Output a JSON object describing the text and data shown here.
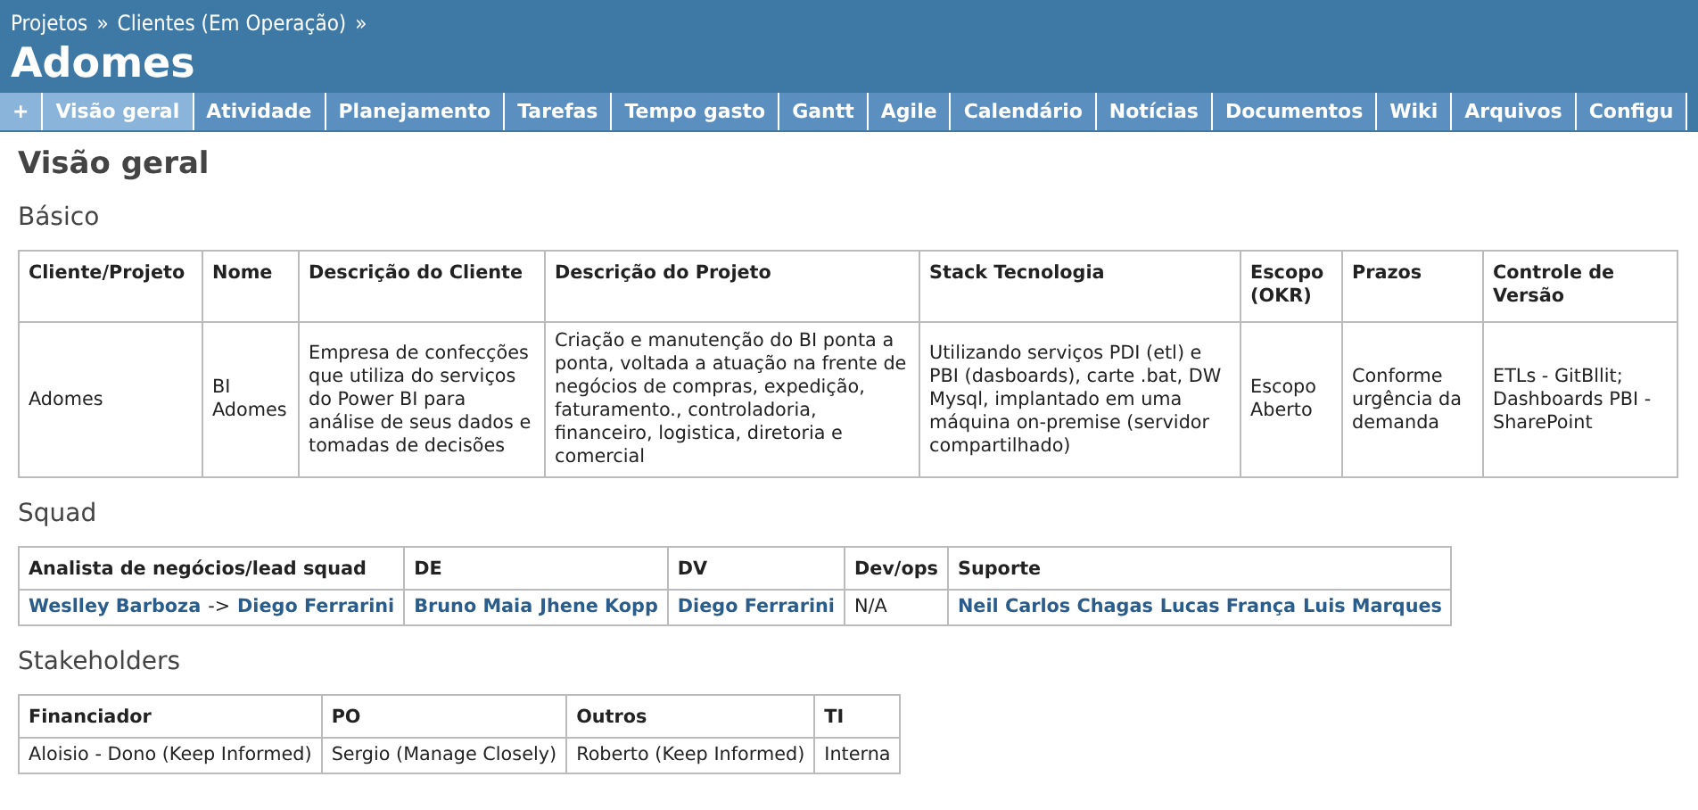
{
  "breadcrumb": [
    {
      "label": "Projetos"
    },
    {
      "label": "Clientes (Em Operação)"
    }
  ],
  "breadcrumb_separator": "»",
  "project_title": "Adomes",
  "new_button": {
    "label": "+"
  },
  "tabs": [
    {
      "label": "Visão geral",
      "selected": true
    },
    {
      "label": "Atividade",
      "selected": false
    },
    {
      "label": "Planejamento",
      "selected": false
    },
    {
      "label": "Tarefas",
      "selected": false
    },
    {
      "label": "Tempo gasto",
      "selected": false
    },
    {
      "label": "Gantt",
      "selected": false
    },
    {
      "label": "Agile",
      "selected": false
    },
    {
      "label": "Calendário",
      "selected": false
    },
    {
      "label": "Notícias",
      "selected": false
    },
    {
      "label": "Documentos",
      "selected": false
    },
    {
      "label": "Wiki",
      "selected": false
    },
    {
      "label": "Arquivos",
      "selected": false
    },
    {
      "label": "Configu",
      "selected": false
    }
  ],
  "page_title": "Visão geral",
  "sections": [
    {
      "title": "Básico",
      "columns": [
        "Cliente/Projeto",
        "Nome",
        "Descrição do Cliente",
        "Descrição do Projeto",
        "Stack Tecnologia",
        "Escopo (OKR)",
        "Prazos",
        "Controle de Versão"
      ],
      "rows": [
        [
          [
            {
              "kind": "text",
              "text": "Adomes"
            }
          ],
          [
            {
              "kind": "text",
              "text": "BI Adomes"
            }
          ],
          [
            {
              "kind": "text",
              "text": "Empresa de confecções que utiliza do serviços do Power BI para análise de seus dados e tomadas de decisões"
            }
          ],
          [
            {
              "kind": "text",
              "text": "Criação e manutenção do BI ponta a ponta, voltada a atuação na frente de negócios de compras, expedição, faturamento., controladoria, financeiro, logistica, diretoria e comercial"
            }
          ],
          [
            {
              "kind": "text",
              "text": "Utilizando serviços PDI (etl) e PBI (dasboards), carte .bat, DW Mysql, implantado em uma máquina on-premise (servidor compartilhado)"
            }
          ],
          [
            {
              "kind": "text",
              "text": "Escopo Aberto"
            }
          ],
          [
            {
              "kind": "text",
              "text": "Conforme urgência da demanda"
            }
          ],
          [
            {
              "kind": "text",
              "text": "ETLs - GitBllit; Dashboards PBI - SharePoint"
            }
          ]
        ]
      ]
    },
    {
      "title": "Squad",
      "columns": [
        "Analista de negócios/lead squad",
        "DE",
        "DV",
        "Dev/ops",
        "Suporte"
      ],
      "rows": [
        [
          [
            {
              "kind": "link",
              "text": "Weslley Barboza"
            },
            {
              "kind": "text",
              "text": "->"
            },
            {
              "kind": "link",
              "text": "Diego Ferrarini"
            }
          ],
          [
            {
              "kind": "link",
              "text": "Bruno Maia"
            },
            {
              "kind": "link",
              "text": "Jhene Kopp"
            }
          ],
          [
            {
              "kind": "link",
              "text": "Diego Ferrarini"
            }
          ],
          [
            {
              "kind": "text",
              "text": "N/A"
            }
          ],
          [
            {
              "kind": "link",
              "text": "Neil Carlos Chagas"
            },
            {
              "kind": "link",
              "text": "Lucas França"
            },
            {
              "kind": "link",
              "text": "Luis Marques"
            }
          ]
        ]
      ]
    },
    {
      "title": "Stakeholders",
      "columns": [
        "Financiador",
        "PO",
        "Outros",
        "TI"
      ],
      "rows": [
        [
          [
            {
              "kind": "text",
              "text": "Aloisio - Dono (Keep Informed)"
            }
          ],
          [
            {
              "kind": "text",
              "text": "Sergio (Manage Closely)"
            }
          ],
          [
            {
              "kind": "text",
              "text": "Roberto (Keep Informed)"
            }
          ],
          [
            {
              "kind": "text",
              "text": "Interna"
            }
          ]
        ]
      ]
    }
  ]
}
